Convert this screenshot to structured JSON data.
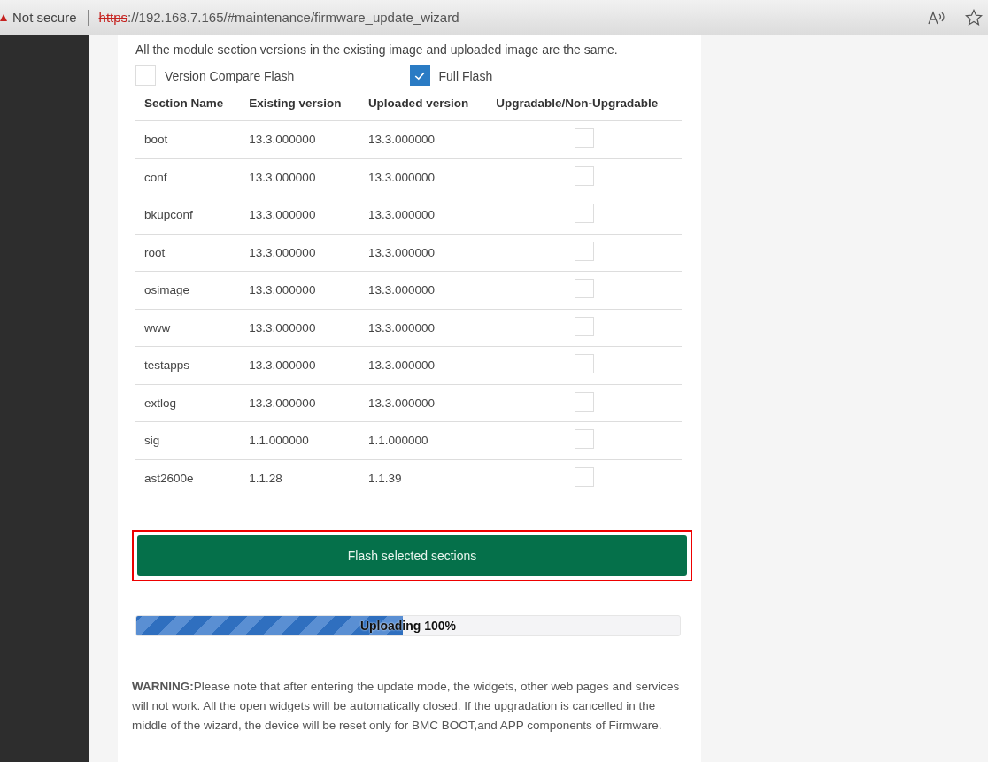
{
  "address_bar": {
    "security": "Not secure",
    "url_scheme": "https",
    "url_rest": "://192.168.7.165/#maintenance/firmware_update_wizard"
  },
  "notice": "All the module section versions in the existing image and uploaded image are the same.",
  "flash_options": [
    {
      "label": "Version Compare Flash",
      "checked": false
    },
    {
      "label": "Full Flash",
      "checked": true
    }
  ],
  "table": {
    "columns": [
      "Section Name",
      "Existing version",
      "Uploaded version",
      "Upgradable/Non-Upgradable"
    ],
    "rows": [
      {
        "cells": [
          "boot",
          "13.3.000000",
          "13.3.000000"
        ],
        "checked": false
      },
      {
        "cells": [
          "conf",
          "13.3.000000",
          "13.3.000000"
        ],
        "checked": false
      },
      {
        "cells": [
          "bkupconf",
          "13.3.000000",
          "13.3.000000"
        ],
        "checked": false
      },
      {
        "cells": [
          "root",
          "13.3.000000",
          "13.3.000000"
        ],
        "checked": false
      },
      {
        "cells": [
          "osimage",
          "13.3.000000",
          "13.3.000000"
        ],
        "checked": false
      },
      {
        "cells": [
          "www",
          "13.3.000000",
          "13.3.000000"
        ],
        "checked": false
      },
      {
        "cells": [
          "testapps",
          "13.3.000000",
          "13.3.000000"
        ],
        "checked": false
      },
      {
        "cells": [
          "extlog",
          "13.3.000000",
          "13.3.000000"
        ],
        "checked": false
      },
      {
        "cells": [
          "sig",
          "1.1.000000",
          "1.1.000000"
        ],
        "checked": false
      },
      {
        "cells": [
          "ast2600e",
          "1.1.28",
          "1.1.39"
        ],
        "checked": false
      }
    ]
  },
  "flash_button": "Flash selected sections",
  "progress": {
    "label": "Uploading 100%",
    "level": 0.49
  },
  "warning": "**WARNING:**Please note that after entering the update mode, the widgets, other web pages and services will not work. All the open widgets will be automatically closed. If the upgradation is cancelled in the middle of the wizard, the device will be reset only for BMC BOOT,and APP components of Firmware."
}
